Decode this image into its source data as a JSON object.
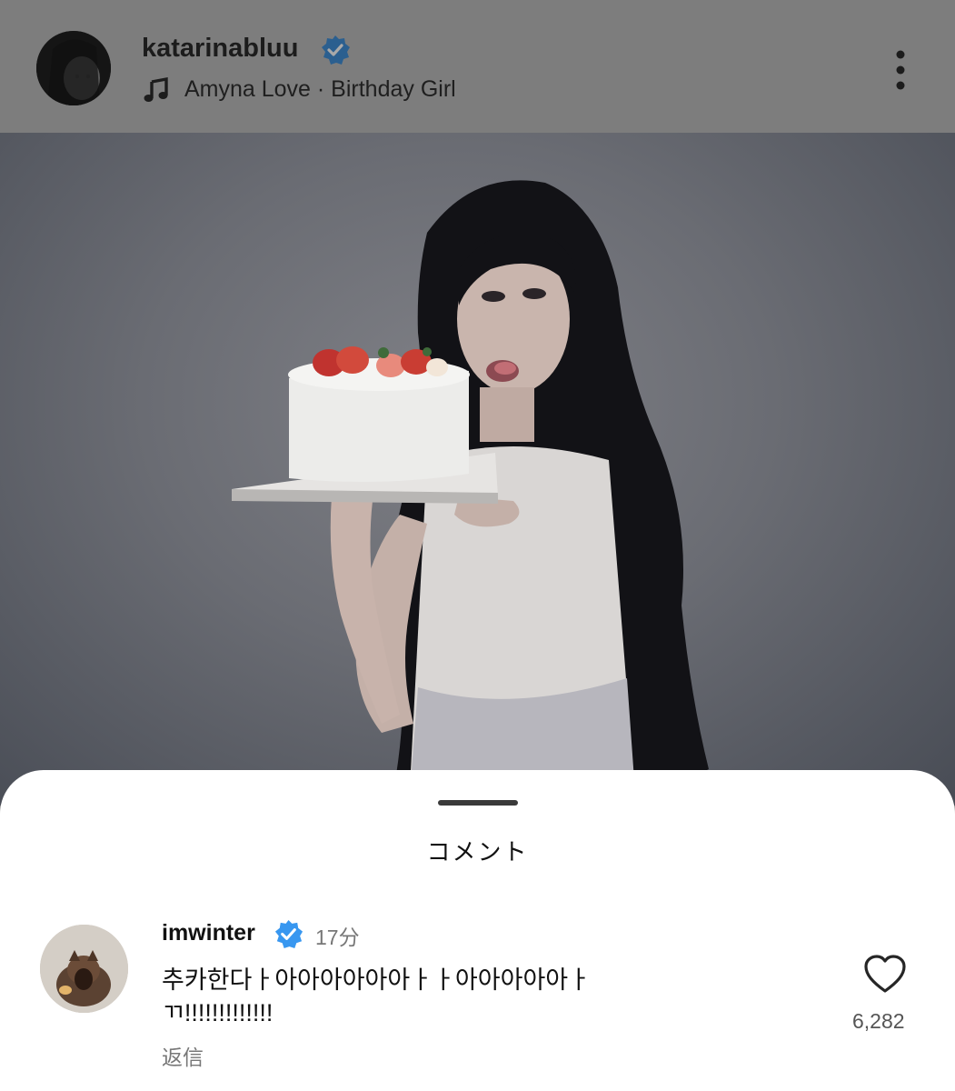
{
  "post": {
    "username": "katarinabluu",
    "music": "Amyna Love · Birthday Girl",
    "icons": {
      "avatar": "profile-avatar",
      "verified": "verified-badge-icon",
      "music": "music-note-icon",
      "more": "more-vertical-icon"
    }
  },
  "sheet": {
    "title": "コメント"
  },
  "comment": {
    "username": "imwinter",
    "time": "17分",
    "text": "추카한다ㅏ아아아아아아ㅏㅏ아아아아아ㅏ\nㄲ!!!!!!!!!!!!!",
    "reply": "返信",
    "likes": "6,282",
    "icons": {
      "verified": "verified-badge-icon",
      "like": "heart-outline-icon"
    }
  },
  "colors": {
    "verified": "#3897f0",
    "overlay": "#7d7d7d",
    "sheet": "#ffffff"
  }
}
